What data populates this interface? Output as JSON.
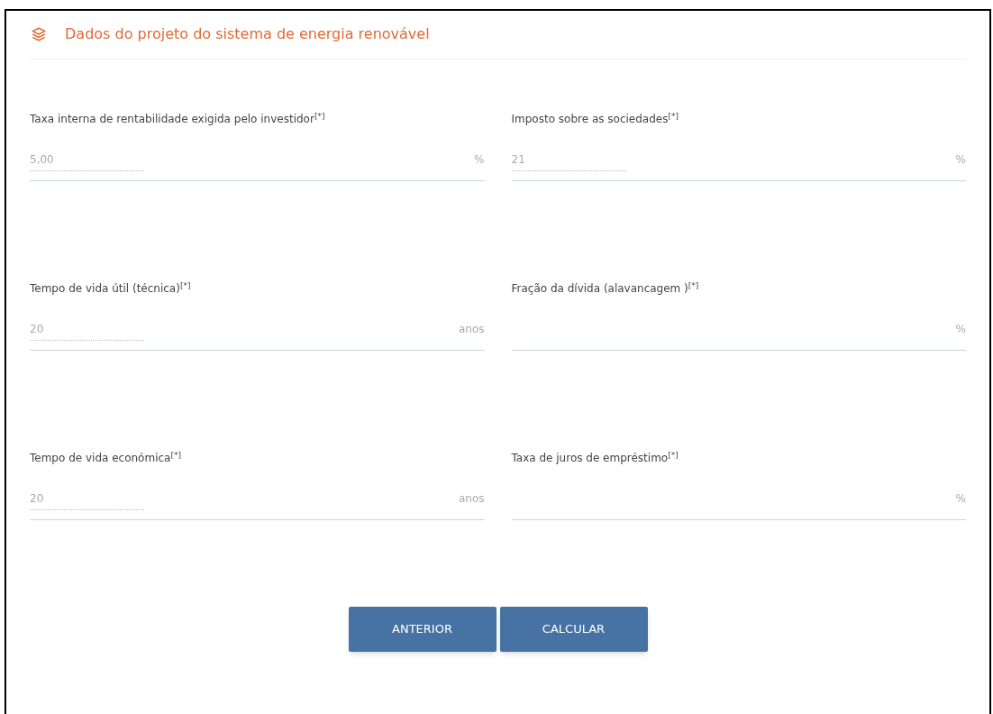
{
  "panel": {
    "title": "Dados do projeto do sistema de energia renovável"
  },
  "fields": [
    {
      "label": "Taxa interna de rentabilidade exigida pelo investidor$^{[*]}$",
      "value": "5,00",
      "unit": "%"
    },
    {
      "label": "Imposto sobre as sociedades$^{[*]}$",
      "value": "21",
      "unit": "%"
    },
    {
      "label": "Tempo de vida útil (técnica)$^{[*]}$",
      "value": "20",
      "unit": "anos"
    },
    {
      "label": "Fração da dívida (alavancagem )$^{[*]}$",
      "unit": "%"
    },
    {
      "label": "Tempo de vida económica$^{[*]}$",
      "value": "20",
      "unit": "anos"
    },
    {
      "label": "Taxa de juros de empréstimo$^{[*]}$",
      "unit": "%"
    }
  ],
  "buttons": [
    "ANTERIOR",
    "CALCULAR"
  ]
}
